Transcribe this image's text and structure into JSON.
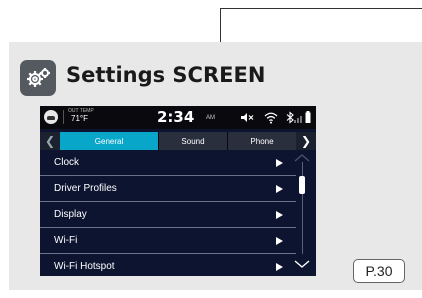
{
  "heading": {
    "title": "Settings SCREEN",
    "icon": "gear-icon",
    "badge_color": "#555a60"
  },
  "statusbar": {
    "out_temp_label": "OUT TEMP",
    "out_temp_value": "71°F",
    "time": "2:34",
    "ampm": "AM",
    "icons": [
      "car-icon",
      "mute-icon",
      "wifi-icon",
      "bluetooth-icon",
      "signal-icon",
      "battery-icon"
    ]
  },
  "tabs": {
    "items": [
      "General",
      "Sound",
      "Phone"
    ],
    "active": "General",
    "active_color": "#08a6c8"
  },
  "menu": {
    "items": [
      "Clock",
      "Driver Profiles",
      "Display",
      "Wi-Fi",
      "Wi-Fi Hotspot"
    ]
  },
  "page_ref": "P.30"
}
